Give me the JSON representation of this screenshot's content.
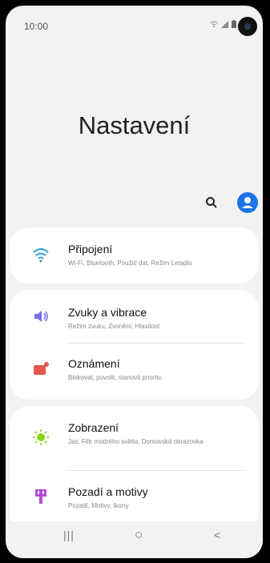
{
  "status_bar": {
    "time": "10:00",
    "icons": [
      "wifi-icon",
      "signal-icon",
      "battery-icon"
    ]
  },
  "page": {
    "title": "Nastavení"
  },
  "toolbar": {
    "search_icon": "search-icon",
    "profile_icon": "account-icon"
  },
  "settings": [
    {
      "label": "Připojení",
      "sub": "Wi-Fi, Bluetooth, Použití dat, Režim Letadlo",
      "icon": "wifi-icon",
      "color": "#2a9bd7"
    },
    {
      "label": "Zvuky a vibrace",
      "sub": "Režim zvuku, Zvonění, Hlasitost",
      "icon": "speaker-icon",
      "color": "#7b6ef0"
    },
    {
      "label": "Oznámení",
      "sub": "Blokovat, povolit, stanovit prioritu",
      "icon": "notification-icon",
      "color": "#e4584f"
    },
    {
      "label": "Zobrazení",
      "sub": "Jas, Filtr modrého světla, Domovská obrazovka",
      "icon": "brightness-icon",
      "color": "#8bd21a"
    },
    {
      "label": "Pozadí a motivy",
      "sub": "Pozadí, Motivy, Ikony",
      "icon": "paintbrush-icon",
      "color": "#b648d8"
    }
  ],
  "nav": {
    "recent": "|||",
    "home": "○",
    "back": "<"
  }
}
